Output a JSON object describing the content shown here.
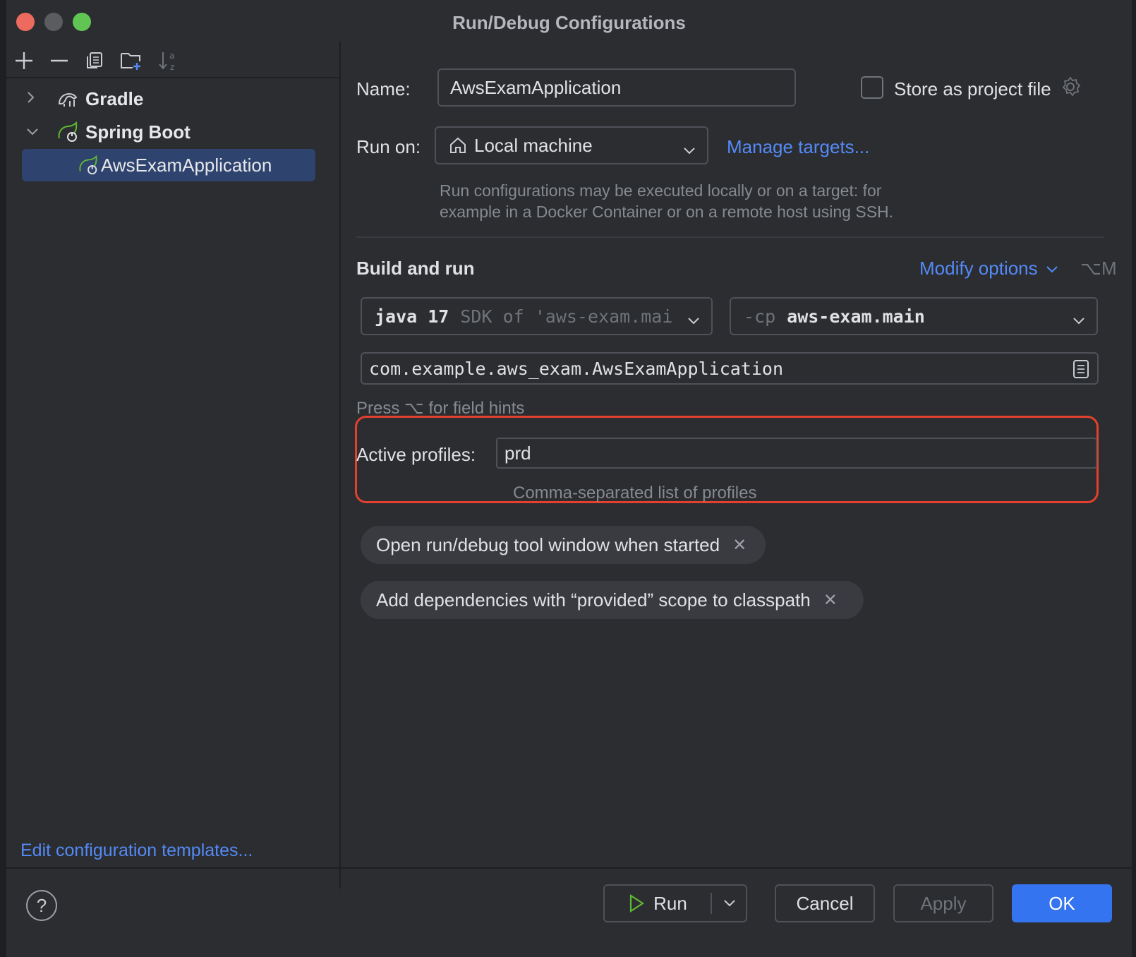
{
  "window": {
    "title": "Run/Debug Configurations"
  },
  "toolbar": {
    "icons": [
      "add-icon",
      "remove-icon",
      "copy-icon",
      "new-folder-icon",
      "sort-icon"
    ]
  },
  "tree": {
    "gradle": {
      "label": "Gradle",
      "expanded": false
    },
    "spring_boot": {
      "label": "Spring Boot",
      "expanded": true
    },
    "selected_item": {
      "label": "AwsExamApplication"
    }
  },
  "edit_templates_label": "Edit configuration templates...",
  "form": {
    "name_label": "Name:",
    "name_value": "AwsExamApplication",
    "store_label": "Store as project file",
    "store_checked": false,
    "run_on_label": "Run on:",
    "run_on_value": "Local machine",
    "manage_targets": "Manage targets...",
    "run_on_hint_line1": "Run configurations may be executed locally or on a target: for",
    "run_on_hint_line2": "example in a Docker Container or on a remote host using SSH.",
    "build_run_title": "Build and run",
    "modify_options": "Modify options",
    "modify_shortcut": "⌥M",
    "jdk_bold": "java 17",
    "jdk_dim": "SDK of 'aws-exam.mai",
    "cp_dim": "-cp",
    "cp_value": "aws-exam.main",
    "main_class": "com.example.aws_exam.AwsExamApplication",
    "field_hint": "Press ⌥ for field hints",
    "profiles_label": "Active profiles:",
    "profiles_value": "prd",
    "profiles_hint": "Comma-separated list of profiles",
    "chips": [
      "Open run/debug tool window when started",
      "Add dependencies with “provided” scope to classpath"
    ]
  },
  "footer": {
    "help": "?",
    "run": "Run",
    "cancel": "Cancel",
    "apply": "Apply",
    "ok": "OK"
  },
  "colors": {
    "accent": "#3574f0",
    "link": "#548af7",
    "highlight": "#e3402f",
    "spring": "#5fb832"
  }
}
